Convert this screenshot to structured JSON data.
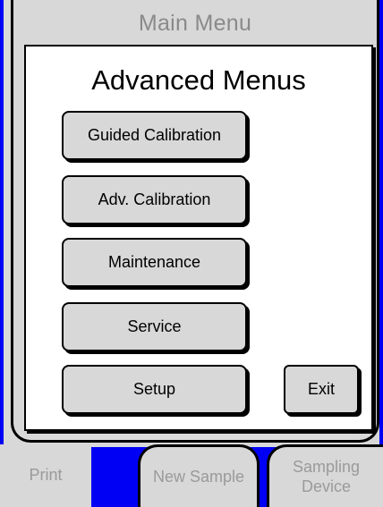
{
  "main_menu": {
    "title": "Main Menu"
  },
  "dialog": {
    "title": "Advanced Menus",
    "buttons": {
      "guided_calibration": "Guided Calibration",
      "adv_calibration": "Adv. Calibration",
      "maintenance": "Maintenance",
      "service": "Service",
      "setup": "Setup",
      "exit": "Exit"
    }
  },
  "bottom_tabs": {
    "print": "Print",
    "new_sample": "New Sample",
    "sampling_device_line1": "Sampling",
    "sampling_device_line2": "Device"
  },
  "colors": {
    "accent_blue": "#0000f4",
    "panel_gray": "#d8d8d8",
    "disabled_text": "#9a9a9a"
  }
}
